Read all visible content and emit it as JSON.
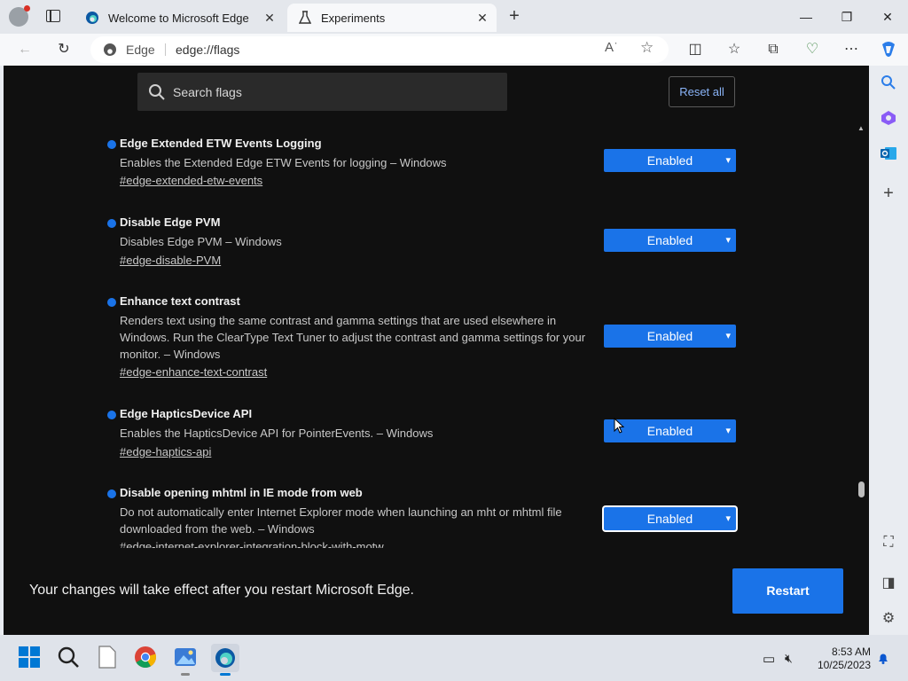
{
  "browser": {
    "tabs": [
      {
        "label": "Welcome to Microsoft Edge",
        "active": false
      },
      {
        "label": "Experiments",
        "active": true
      }
    ],
    "address": {
      "site_label": "Edge",
      "url": "edge://flags"
    },
    "window_controls": {
      "minimize": "—",
      "restore": "❐",
      "close": "✕"
    }
  },
  "flags_page": {
    "search": {
      "placeholder": "Search flags"
    },
    "reset_all_label": "Reset all",
    "experiments": [
      {
        "title": "Edge Extended ETW Events Logging",
        "description": "Enables the Extended Edge ETW Events for logging – Windows",
        "link": "#edge-extended-etw-events",
        "state": "Enabled"
      },
      {
        "title": "Disable Edge PVM",
        "description": "Disables Edge PVM – Windows",
        "link": "#edge-disable-PVM",
        "state": "Enabled"
      },
      {
        "title": "Enhance text contrast",
        "description": "Renders text using the same contrast and gamma settings that are used elsewhere in Windows. Run the ClearType Text Tuner to adjust the contrast and gamma settings for your monitor. – Windows",
        "link": "#edge-enhance-text-contrast",
        "state": "Enabled"
      },
      {
        "title": "Edge HapticsDevice API",
        "description": "Enables the HapticsDevice API for PointerEvents. – Windows",
        "link": "#edge-haptics-api",
        "state": "Enabled"
      },
      {
        "title": "Disable opening mhtml in IE mode from web",
        "description": "Do not automatically enter Internet Explorer mode when launching an mht or mhtml file downloaded from the web. – Windows",
        "link": "#edge-internet-explorer-integration-block-with-motw",
        "state": "Enabled"
      }
    ],
    "footer": {
      "message": "Your changes will take effect after you restart Microsoft Edge.",
      "restart_label": "Restart"
    }
  },
  "taskbar": {
    "time": "8:53 AM",
    "date": "10/25/2023"
  },
  "colors": {
    "accent": "#1a73e8",
    "page_bg": "#101010",
    "link": "#8ab4f8"
  }
}
